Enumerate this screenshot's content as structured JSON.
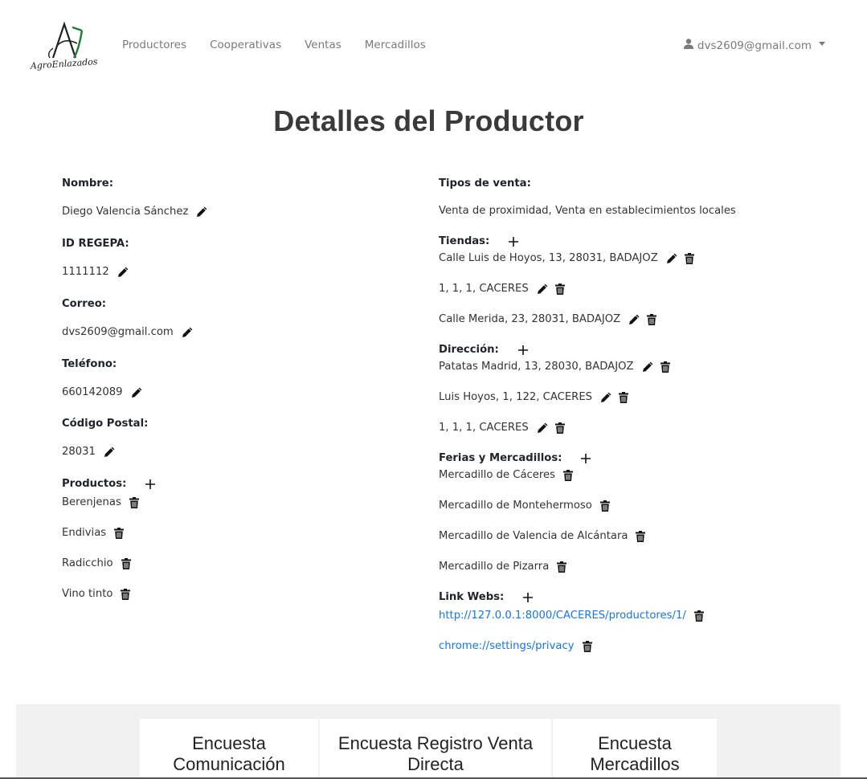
{
  "nav": {
    "links": [
      "Productores",
      "Cooperativas",
      "Ventas",
      "Mercadillos"
    ],
    "user_email": "dvs2609@gmail.com"
  },
  "page_title": "Detalles del Productor",
  "left": {
    "nombre_label": "Nombre:",
    "nombre": "Diego Valencia Sánchez",
    "regepa_label": "ID REGEPA:",
    "regepa": "1111112",
    "correo_label": "Correo:",
    "correo": "dvs2609@gmail.com",
    "telefono_label": "Teléfono:",
    "telefono": "660142089",
    "cp_label": "Código Postal:",
    "cp": "28031",
    "productos_label": "Productos:",
    "productos": [
      "Berenjenas",
      "Endivias",
      "Radicchio",
      "Vino tinto"
    ]
  },
  "right": {
    "tipos_label": "Tipos de venta:",
    "tipos": "Venta de proximidad, Venta en establecimientos locales",
    "tiendas_label": "Tiendas:",
    "tiendas": [
      "Calle Luis de Hoyos, 13, 28031, BADAJOZ",
      "1, 1, 1, CACERES",
      "Calle Merida, 23, 28031, BADAJOZ"
    ],
    "direccion_label": "Dirección:",
    "direcciones": [
      "Patatas Madrid, 13, 28030, BADAJOZ",
      "Luis Hoyos, 1, 122, CACERES",
      "1, 1, 1, CACERES"
    ],
    "ferias_label": "Ferias y Mercadillos:",
    "ferias": [
      "Mercadillo de Cáceres",
      "Mercadillo de Montehermoso",
      "Mercadillo de Valencia de Alcántara",
      "Mercadillo de Pizarra"
    ],
    "links_label": "Link Webs:",
    "links": [
      "http://127.0.0.1:8000/CACERES/productores/1/",
      "chrome://settings/privacy"
    ]
  },
  "surveys": [
    "Encuesta Comunicación",
    "Encuesta Registro Venta Directa",
    "Encuesta Mercadillos"
  ],
  "colors": {
    "link": "#1a73e8",
    "logo_green": "#1f7a3a",
    "footer_bg": "#f1f1f1"
  },
  "logo_text": "AgroEnlazados"
}
